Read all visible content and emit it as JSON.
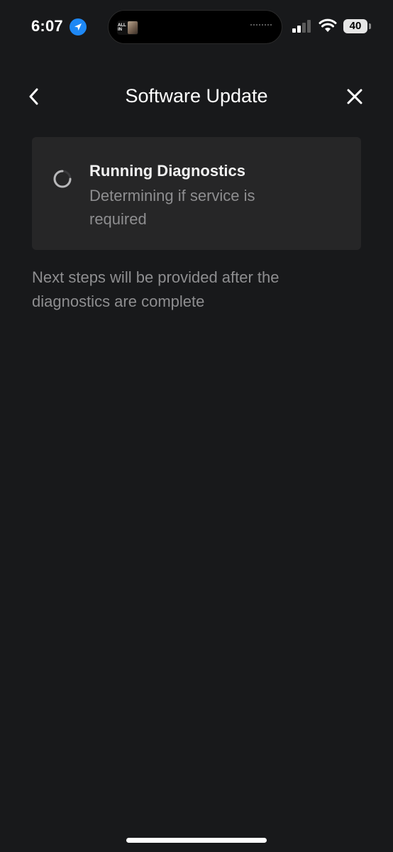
{
  "status_bar": {
    "time": "6:07",
    "battery": "40",
    "island_artwork_text": "ALL IN"
  },
  "header": {
    "title": "Software Update",
    "back_icon": "chevron-left-icon",
    "close_icon": "close-icon"
  },
  "diagnostics_card": {
    "title": "Running Diagnostics",
    "description": "Determining if service is required",
    "spinner_icon": "loading-spinner-icon"
  },
  "footnote": "Next steps will be provided after the diagnostics are complete",
  "colors": {
    "background": "#18191b",
    "card": "#262627",
    "secondary_text": "#8e8e90",
    "location_accent": "#1e88f5"
  }
}
